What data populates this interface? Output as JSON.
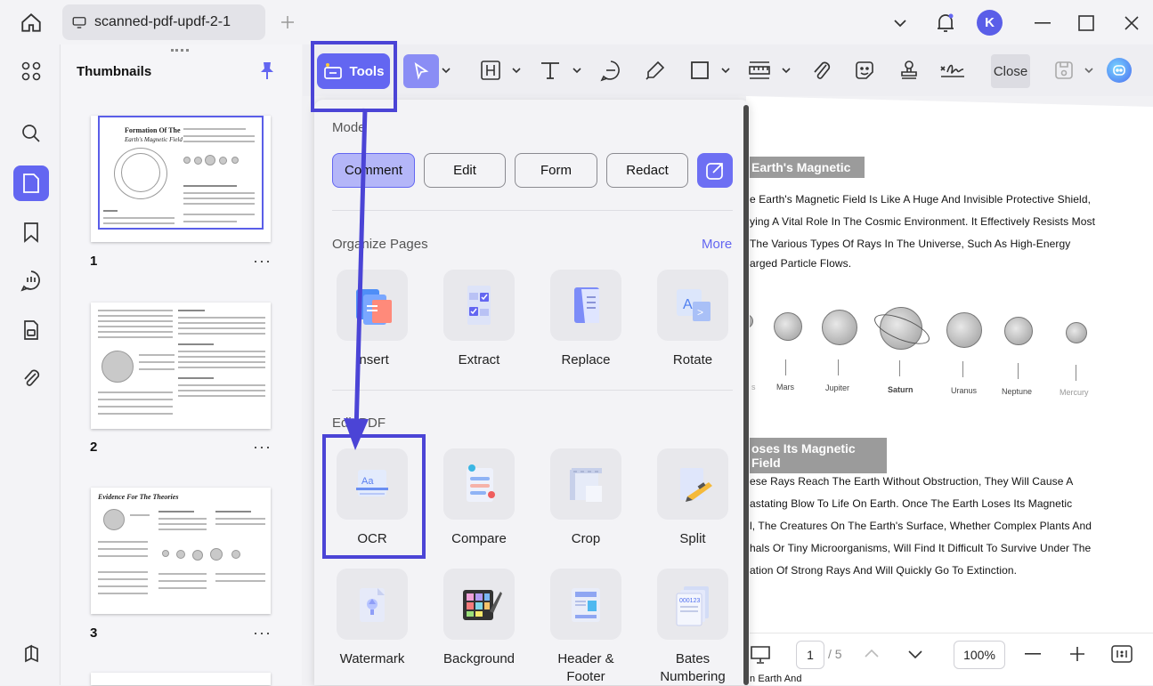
{
  "titlebar": {
    "tab_title": "scanned-pdf-updf-2-1",
    "avatar_letter": "K"
  },
  "thumbnails": {
    "title": "Thumbnails",
    "pages": [
      {
        "number": "1",
        "heading": "Formation Of The",
        "subheading": "Earth's Magnetic Field"
      },
      {
        "number": "2"
      },
      {
        "number": "3",
        "heading": "Evidence For The Theories"
      }
    ],
    "more": "···"
  },
  "toolbar": {
    "tools_label": "Tools",
    "close_label": "Close"
  },
  "tools_panel": {
    "mode": {
      "title": "Mode",
      "buttons": [
        "Comment",
        "Edit",
        "Form",
        "Redact"
      ],
      "active": "Comment"
    },
    "organize": {
      "title": "Organize Pages",
      "more": "More",
      "items": [
        "Insert",
        "Extract",
        "Replace",
        "Rotate"
      ]
    },
    "edit_pdf": {
      "title": "Edit PDF",
      "items": [
        "OCR",
        "Compare",
        "Crop",
        "Split"
      ],
      "items2": [
        "Watermark",
        "Background",
        "Header & Footer",
        "Bates Numbering"
      ]
    }
  },
  "document": {
    "heading1": "Earth's Magnetic",
    "para1": [
      "e Earth's Magnetic Field Is Like A Huge And Invisible Protective Shield,",
      "ying A Vital Role In The Cosmic Environment. It Effectively Resists Most",
      "The Various Types Of Rays In The Universe, Such As High-Energy",
      "arged Particle Flows."
    ],
    "planets": [
      "s",
      "Mars",
      "Jupiter",
      "Saturn",
      "Uranus",
      "Neptune",
      "Mercury"
    ],
    "heading2": "oses Its Magnetic Field",
    "para2": [
      "ese Rays Reach The Earth Without Obstruction, They Will Cause A",
      "astating Blow To Life On Earth. Once The Earth Loses Its Magnetic",
      "l, The Creatures On The Earth's Surface, Whether Complex Plants And",
      "hals Or Tiny Microorganisms, Will Find It Difficult To Survive Under The",
      "ation Of Strong Rays And Will Quickly Go To Extinction."
    ],
    "footer_text": "n Earth And"
  },
  "pagebar": {
    "current_page": "1",
    "total": "/ 5",
    "zoom": "100%"
  },
  "colors": {
    "accent": "#6366f1",
    "annotation": "#4b44d6"
  }
}
